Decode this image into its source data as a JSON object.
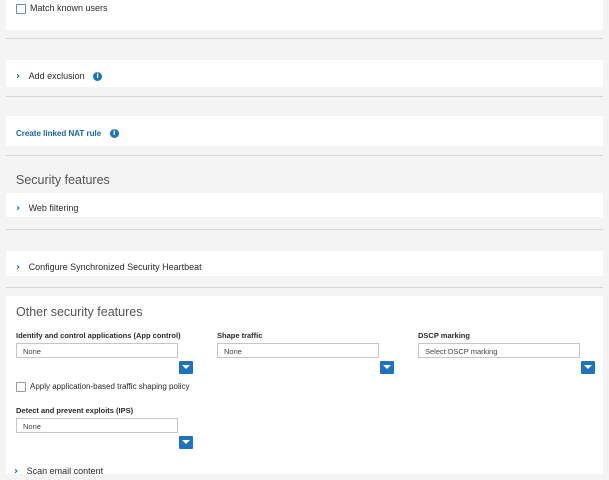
{
  "match_known_users": {
    "label": "Match known users",
    "checked": false
  },
  "add_exclusion": {
    "label": "Add exclusion"
  },
  "linked_nat": {
    "label": "Create linked NAT rule"
  },
  "security_features": {
    "title": "Security features",
    "web_filtering": "Web filtering",
    "heartbeat": "Configure Synchronized Security Heartbeat"
  },
  "other_security": {
    "title": "Other security features",
    "app_control": {
      "label": "Identify and control applications (App control)",
      "value": "None"
    },
    "shape_traffic": {
      "label": "Shape traffic",
      "value": "None"
    },
    "dscp": {
      "label": "DSCP marking",
      "placeholder": "Select DSCP marking"
    },
    "app_shaping": {
      "label": "Apply application-based traffic shaping policy",
      "checked": false
    },
    "ips": {
      "label": "Detect and prevent exploits (IPS)",
      "value": "None"
    },
    "scan_email": "Scan email content"
  },
  "colors": {
    "accent": "#1e73be",
    "link": "#1565a8",
    "background": "#f4f4f4",
    "panel": "#ffffff"
  },
  "icons": [
    "checkbox",
    "chevron-right-icon",
    "info-icon",
    "chevron-down-icon"
  ]
}
